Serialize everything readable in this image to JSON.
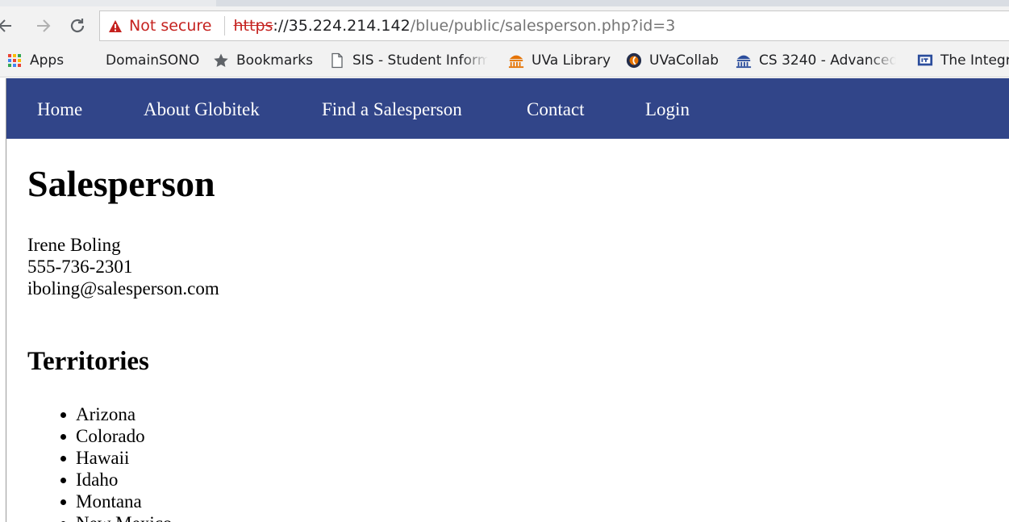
{
  "browser": {
    "security_label": "Not secure",
    "url_scheme": "https",
    "url_host": "://35.224.214.142",
    "url_path": "/blue/public/salesperson.php?id=3"
  },
  "bookmarks": [
    {
      "label": "Apps",
      "icon": "apps-grid-icon"
    },
    {
      "label": "DomainSONO",
      "icon": ""
    },
    {
      "label": "Bookmarks",
      "icon": "star-icon"
    },
    {
      "label": "SIS - Student Informa",
      "icon": "page-icon"
    },
    {
      "label": "UVa Library",
      "icon": "library-icon"
    },
    {
      "label": "UVaCollab",
      "icon": "collab-icon"
    },
    {
      "label": "CS 3240 - Advanced S",
      "icon": "rotunda-icon"
    },
    {
      "label": "The Integr",
      "icon": "its-icon"
    }
  ],
  "site_nav": [
    "Home",
    "About Globitek",
    "Find a Salesperson",
    "Contact",
    "Login"
  ],
  "page": {
    "title": "Salesperson",
    "name": "Irene Boling",
    "phone": "555-736-2301",
    "email": "iboling@salesperson.com",
    "territories_heading": "Territories",
    "territories": [
      "Arizona",
      "Colorado",
      "Hawaii",
      "Idaho",
      "Montana",
      "New Mexico"
    ]
  },
  "colors": {
    "nav_background": "#314589",
    "warning": "#c5221f"
  }
}
